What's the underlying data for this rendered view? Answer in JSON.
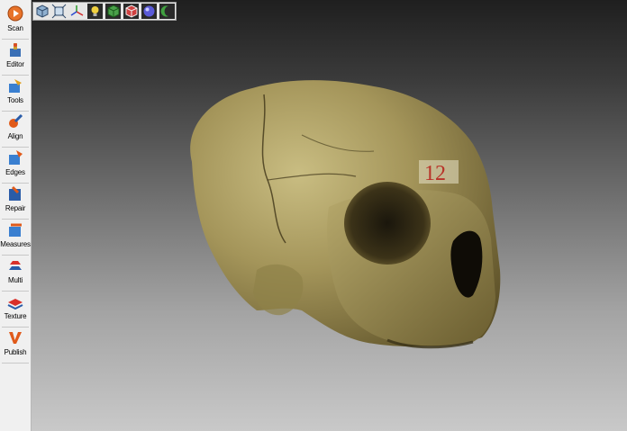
{
  "sidebar": {
    "items": [
      {
        "label": "Scan",
        "icon": "scan-icon"
      },
      {
        "label": "Editor",
        "icon": "editor-icon"
      },
      {
        "label": "Tools",
        "icon": "tools-icon"
      },
      {
        "label": "Align",
        "icon": "align-icon"
      },
      {
        "label": "Edges",
        "icon": "edges-icon"
      },
      {
        "label": "Repair",
        "icon": "repair-icon"
      },
      {
        "label": "Measures",
        "icon": "measures-icon"
      },
      {
        "label": "Multi",
        "icon": "multi-icon"
      },
      {
        "label": "Texture",
        "icon": "texture-icon"
      },
      {
        "label": "Publish",
        "icon": "publish-icon"
      }
    ]
  },
  "toolbar": {
    "buttons": [
      "cube-view-icon",
      "fit-to-view-icon",
      "axes-icon",
      "light-bulb-icon",
      "textured-cube-icon",
      "shaded-cube-icon",
      "sphere-icon",
      "moon-icon"
    ]
  },
  "model": {
    "label_on_specimen": "12",
    "colors": {
      "bone": "#a89a5e",
      "bone_dark": "#5a4e2a",
      "label": "#c0392b"
    }
  }
}
